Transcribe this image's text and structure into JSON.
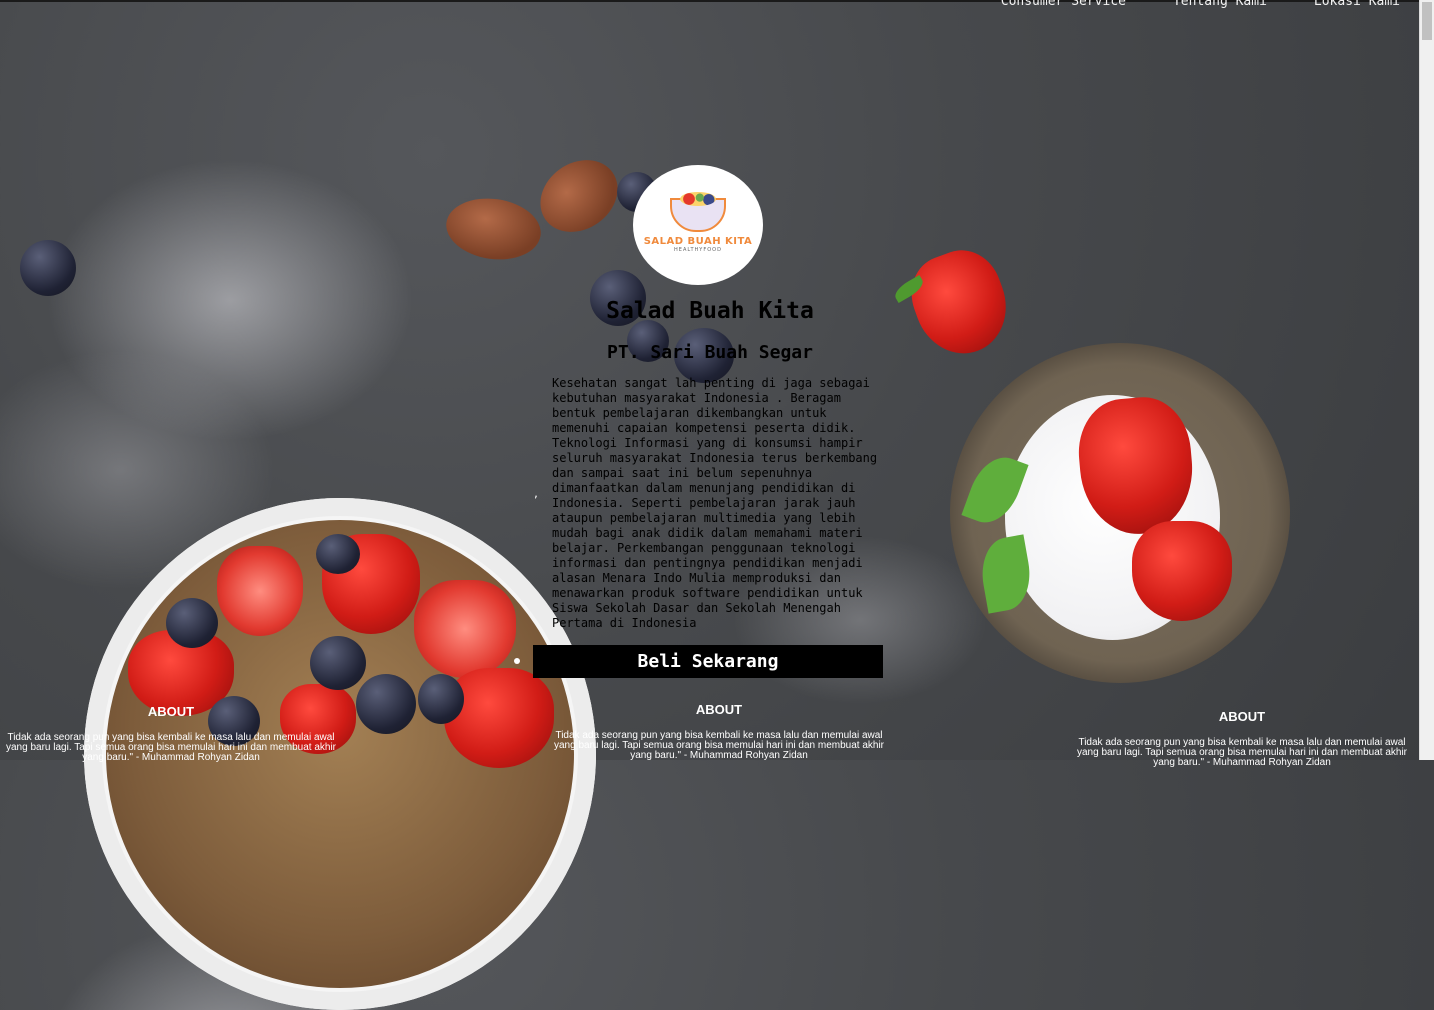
{
  "nav": {
    "items": [
      "Consumer Service",
      "Tentang Kami",
      "Lokasi Kami"
    ]
  },
  "logo": {
    "brand": "SALAD BUAH KITA",
    "tagline": "HEALTHYFOOD"
  },
  "hero": {
    "title": "Salad Buah Kita",
    "company": "PT. Sari Buah Segar",
    "description": "Kesehatan sangat lah penting di jaga sebagai kebutuhan masyarakat Indonesia . Beragam bentuk pembelajaran dikembangkan untuk memenuhi capaian kompetensi peserta didik. Teknologi Informasi yang di konsumsi hampir seluruh masyarakat Indonesia terus berkembang dan sampai saat ini belum sepenuhnya dimanfaatkan dalam menunjang pendidikan di Indonesia. Seperti pembelajaran jarak jauh ataupun pembelajaran multimedia yang lebih mudah bagi anak didik dalam memahami materi belajar. Perkembangan penggunaan teknologi informasi dan pentingnya pendidikan menjadi alasan Menara Indo Mulia memproduksi dan menawarkan produk software pendidikan untuk Siswa Sekolah Dasar dan Sekolah Menengah Pertama di Indonesia",
    "buy_label": "Beli Sekarang"
  },
  "about": [
    {
      "heading": "ABOUT",
      "text": "Tidak ada seorang pun yang bisa kembali ke masa lalu dan memulai awal yang baru lagi. Tapi semua orang bisa memulai hari ini dan membuat akhir yang baru.\" - Muhammad Rohyan Zidan"
    },
    {
      "heading": "ABOUT",
      "text": "Tidak ada seorang pun yang bisa kembali ke masa lalu dan memulai awal yang baru lagi. Tapi semua orang bisa memulai hari ini dan membuat akhir yang baru.\" - Muhammad Rohyan Zidan"
    },
    {
      "heading": "ABOUT",
      "text": "Tidak ada seorang pun yang bisa kembali ke masa lalu dan memulai awal yang baru lagi. Tapi semua orang bisa memulai hari ini dan membuat akhir yang baru.\" - Muhammad Rohyan Zidan"
    }
  ]
}
